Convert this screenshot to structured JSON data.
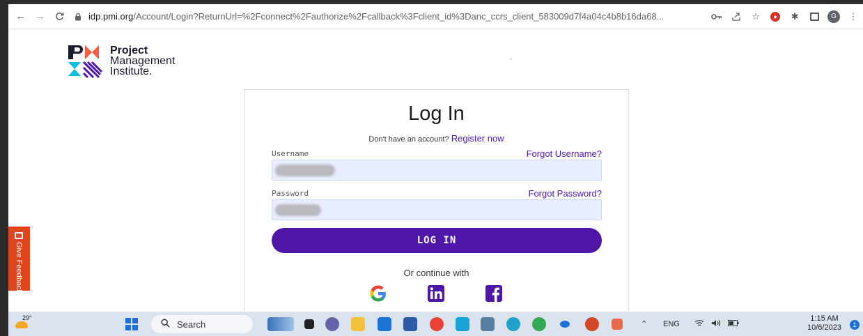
{
  "browser": {
    "url_host": "idp.pmi.org",
    "url_rest": "/Account/Login?ReturnUrl=%2Fconnect%2Fauthorize%2Fcallback%3Fclient_id%3Danc_ccrs_client_583009d7f4a04c4b8b16da68...",
    "avatar_letter": "G"
  },
  "logo": {
    "line1": "Project",
    "line2": "Management",
    "line3": "Institute."
  },
  "login": {
    "title": "Log In",
    "no_account_text": "Don't have an account?",
    "register_link": "Register now",
    "username_label": "Username",
    "forgot_username": "Forgot Username?",
    "password_label": "Password",
    "forgot_password": "Forgot Password?",
    "login_button": "LOG IN",
    "or_continue": "Or continue with",
    "social": [
      "google-icon",
      "linkedin-icon",
      "facebook-icon"
    ]
  },
  "feedback": {
    "label": "Give Feedback"
  },
  "taskbar": {
    "temperature": "29°",
    "search_label": "Search",
    "language": "ENG",
    "time": "1:15 AM",
    "date": "10/6/2023",
    "notification_count": "1"
  },
  "colors": {
    "brand_purple": "#4f17a8",
    "input_bg": "#e8eefe",
    "feedback_orange": "#e0451f"
  }
}
